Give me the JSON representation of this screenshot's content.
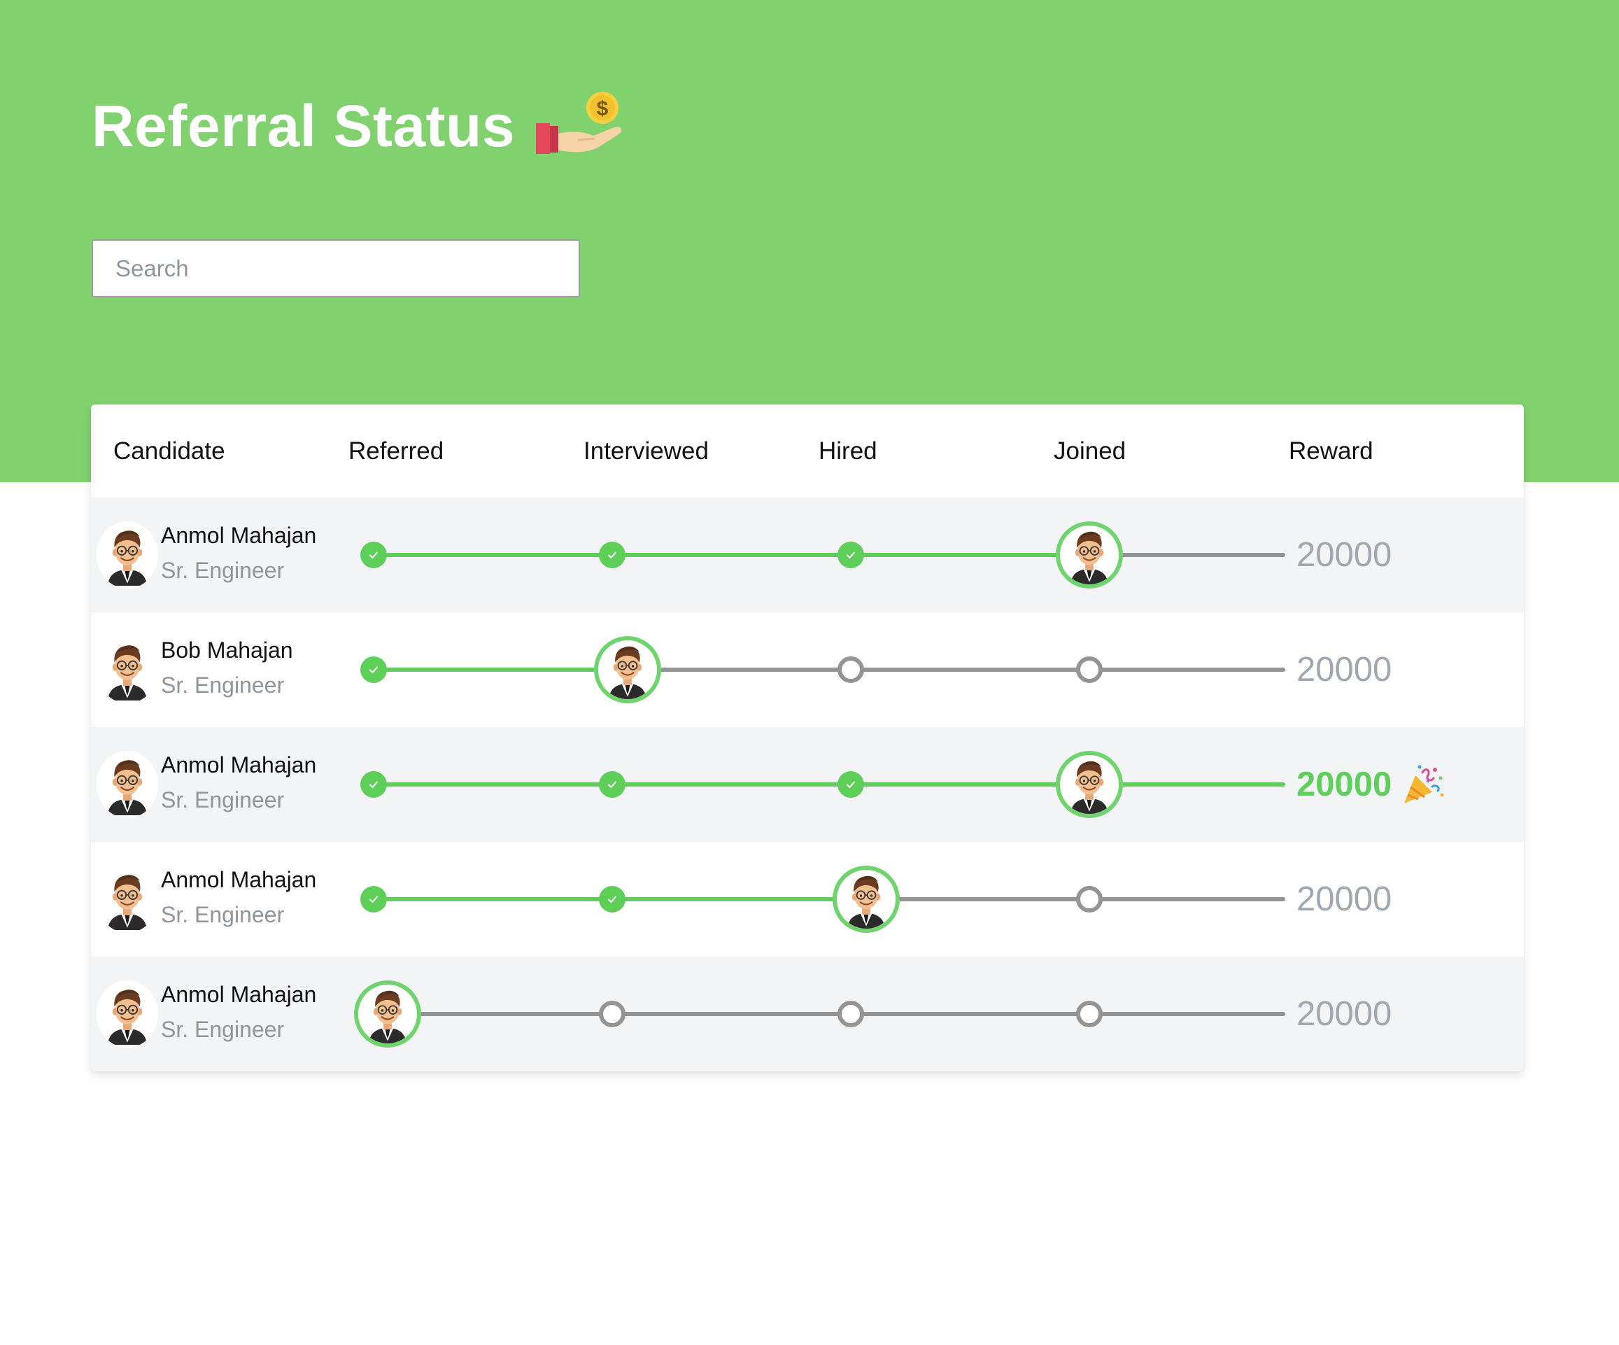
{
  "page": {
    "title": "Referral Status",
    "title_icon": "money-hand-icon",
    "search": {
      "placeholder": "Search",
      "value": ""
    }
  },
  "table": {
    "headers": {
      "candidate": "Candidate",
      "referred": "Referred",
      "interviewed": "Interviewed",
      "hired": "Hired",
      "joined": "Joined",
      "reward": "Reward"
    },
    "stages": [
      "Referred",
      "Interviewed",
      "Hired",
      "Joined"
    ],
    "rows": [
      {
        "name": "Anmol Mahajan",
        "role": "Sr. Engineer",
        "current_stage": "Joined",
        "reward": "20000",
        "reward_earned": false
      },
      {
        "name": "Bob Mahajan",
        "role": "Sr. Engineer",
        "current_stage": "Interviewed",
        "reward": "20000",
        "reward_earned": false
      },
      {
        "name": "Anmol Mahajan",
        "role": "Sr. Engineer",
        "current_stage": "Joined",
        "reward": "20000",
        "reward_earned": true,
        "reward_icon": "party-popper-icon"
      },
      {
        "name": "Anmol Mahajan",
        "role": "Sr. Engineer",
        "current_stage": "Hired",
        "reward": "20000",
        "reward_earned": false
      },
      {
        "name": "Anmol Mahajan",
        "role": "Sr. Engineer",
        "current_stage": "Referred",
        "reward": "20000",
        "reward_earned": false
      }
    ]
  },
  "colors": {
    "header_green": "#82d16f",
    "progress_green": "#5dcf58",
    "progress_grey": "#949494",
    "reward_grey": "#a1a7ae",
    "reward_green": "#5fcf5b",
    "row_alt": "#f3f4f6"
  }
}
